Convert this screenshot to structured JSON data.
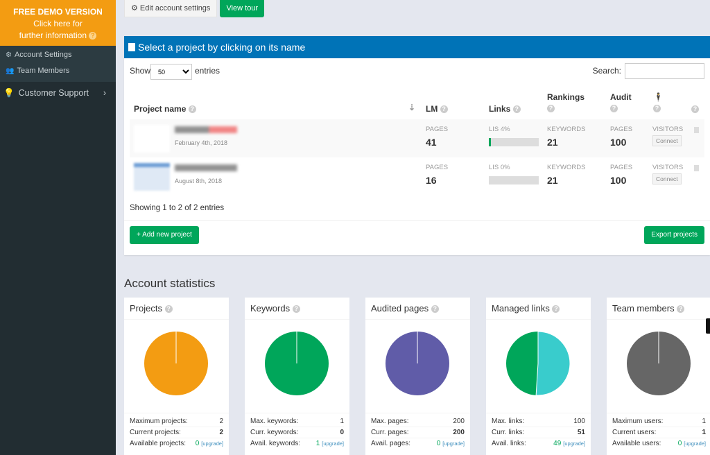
{
  "sidebar": {
    "demo": {
      "title": "FREE DEMO VERSION",
      "line1": "Click here for",
      "line2": "further information"
    },
    "sub_items": [
      {
        "label": "Account Settings",
        "icon": "gears-icon"
      },
      {
        "label": "Team Members",
        "icon": "users-icon"
      }
    ],
    "support": {
      "label": "Customer Support",
      "icon": "lightbulb-icon"
    }
  },
  "topbar": {
    "edit_label": "Edit account settings",
    "tour_label": "View tour"
  },
  "projects": {
    "header": "Select a project by clicking on its name",
    "show": "Show",
    "page_size": "50",
    "entries": "entries",
    "search_label": "Search:",
    "search_value": "",
    "columns": {
      "name": "Project name",
      "lm": "LM",
      "links": "Links",
      "rankings": "Rankings",
      "audit": "Audit"
    },
    "rows": [
      {
        "date": "February 4th, 2018",
        "lm_label": "PAGES",
        "lm": "41",
        "links_label": "LIS 4%",
        "lis_percent": 4,
        "rank_label": "KEYWORDS",
        "rank": "21",
        "audit_label": "PAGES",
        "audit": "100",
        "visitors_label": "VISITORS",
        "connect": "Connect"
      },
      {
        "date": "August 8th, 2018",
        "lm_label": "PAGES",
        "lm": "16",
        "links_label": "LIS 0%",
        "lis_percent": 0,
        "rank_label": "KEYWORDS",
        "rank": "21",
        "audit_label": "PAGES",
        "audit": "100",
        "visitors_label": "VISITORS",
        "connect": "Connect"
      }
    ],
    "info": "Showing 1 to 2 of 2 entries",
    "add_label": "+ Add new project",
    "export_label": "Export projects"
  },
  "stats": {
    "title": "Account statistics",
    "upgrade": "[upgrade]",
    "cards": [
      {
        "title": "Projects",
        "color": "#f39c12",
        "used_fraction": 1.0,
        "free_color": "#f39c12",
        "rows": [
          [
            "Maximum projects:",
            "2"
          ],
          [
            "Current projects:",
            "2"
          ],
          [
            "Available projects:",
            "0"
          ]
        ]
      },
      {
        "title": "Keywords",
        "color": "#00a65a",
        "used_fraction": 1.0,
        "free_color": "#00a65a",
        "rows": [
          [
            "Max. keywords:",
            "1"
          ],
          [
            "Curr. keywords:",
            "0"
          ],
          [
            "Avail. keywords:",
            "1"
          ]
        ]
      },
      {
        "title": "Audited pages",
        "color": "#605ca8",
        "used_fraction": 1.0,
        "free_color": "#605ca8",
        "rows": [
          [
            "Max. pages:",
            "200"
          ],
          [
            "Curr. pages:",
            "200"
          ],
          [
            "Avail. pages:",
            "0"
          ]
        ]
      },
      {
        "title": "Managed links",
        "color": "#39cccc",
        "used_fraction": 0.51,
        "free_color": "#00a65a",
        "rows": [
          [
            "Max. links:",
            "100"
          ],
          [
            "Curr. links:",
            "51"
          ],
          [
            "Avail. links:",
            "49"
          ]
        ]
      },
      {
        "title": "Team members",
        "color": "#666666",
        "used_fraction": 1.0,
        "free_color": "#666666",
        "rows": [
          [
            "Maximum users:",
            "1"
          ],
          [
            "Current users:",
            "1"
          ],
          [
            "Available users:",
            "0"
          ]
        ]
      }
    ]
  }
}
